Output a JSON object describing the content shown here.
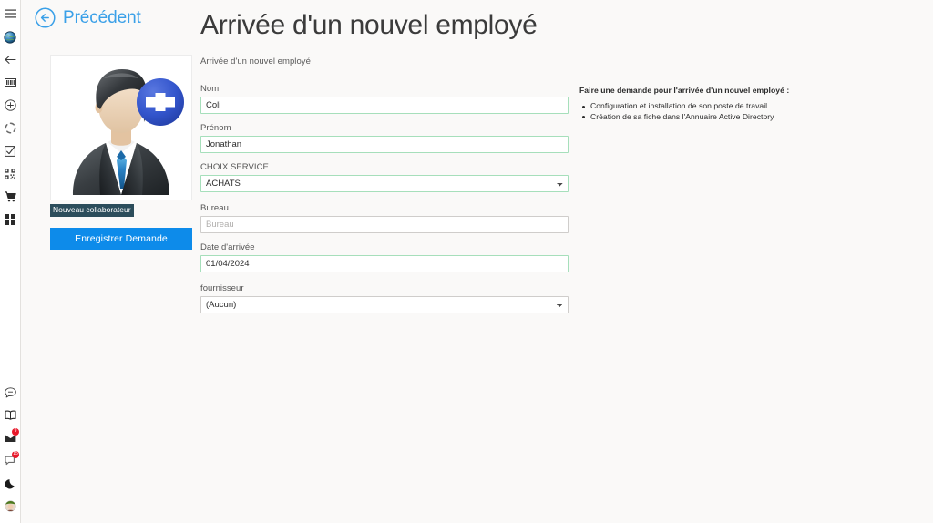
{
  "rail": {
    "top_items": [
      {
        "name": "menu-icon",
        "label": "Menu"
      },
      {
        "name": "globe-icon",
        "label": "Globe"
      },
      {
        "name": "back-arrow-icon",
        "label": "Retour"
      },
      {
        "name": "id-card-icon",
        "label": "Carte"
      },
      {
        "name": "plus-circle-icon",
        "label": "Ajouter"
      },
      {
        "name": "refresh-icon",
        "label": "Actualiser"
      },
      {
        "name": "form-check-icon",
        "label": "Formulaire"
      },
      {
        "name": "qrcode-icon",
        "label": "QR Code"
      },
      {
        "name": "cart-icon",
        "label": "Panier"
      },
      {
        "name": "grid-icon",
        "label": "Applications"
      }
    ],
    "bottom_items": [
      {
        "name": "chat-icon",
        "label": "Messages",
        "badge": ""
      },
      {
        "name": "book-icon",
        "label": "Documentation",
        "badge": ""
      },
      {
        "name": "mail-icon",
        "label": "Courrier",
        "badge": "9"
      },
      {
        "name": "notification-icon",
        "label": "Notifications",
        "badge": "15"
      },
      {
        "name": "moon-icon",
        "label": "Mode sombre",
        "badge": ""
      },
      {
        "name": "user-avatar-icon",
        "label": "Profil",
        "badge": ""
      }
    ]
  },
  "header": {
    "back_label": "Précédent",
    "title": "Arrivée d'un nouvel employé"
  },
  "left_panel": {
    "avatar_caption": "Nouveau collaborateur",
    "save_button": "Enregistrer Demande"
  },
  "form": {
    "subtitle": "Arrivée d'un nouvel employé",
    "fields": [
      {
        "label": "Nom",
        "value": "Coli",
        "placeholder": "Nom",
        "type": "text",
        "state": "valid"
      },
      {
        "label": "Prénom",
        "value": "Jonathan",
        "placeholder": "Prénom",
        "type": "text",
        "state": "valid"
      },
      {
        "label": "CHOIX SERVICE",
        "value": "ACHATS",
        "placeholder": "",
        "type": "select",
        "state": "valid",
        "options": [
          "ACHATS"
        ]
      },
      {
        "label": "Bureau",
        "value": "",
        "placeholder": "Bureau",
        "type": "text",
        "state": "neutral"
      },
      {
        "label": "Date d'arrivée",
        "value": "01/04/2024",
        "placeholder": "",
        "type": "text",
        "state": "valid"
      },
      {
        "label": "fournisseur",
        "value": "(Aucun)",
        "placeholder": "",
        "type": "select",
        "state": "neutral",
        "options": [
          "(Aucun)"
        ]
      }
    ]
  },
  "info_panel": {
    "title": "Faire une demande pour l'arrivée d'un nouvel employé :",
    "items": [
      "Configuration et installation de son poste de travail",
      "Création de sa fiche dans l'Annuaire Active Directory"
    ]
  },
  "colors": {
    "accent_blue": "#0d8bea",
    "link_blue": "#3aa0e8",
    "valid_border": "#a6dfbb",
    "neutral_border": "#cfcdcb",
    "tooltip_bg": "#2c4d5b",
    "badge_red": "#e8182a",
    "page_bg": "#faf9f8"
  }
}
